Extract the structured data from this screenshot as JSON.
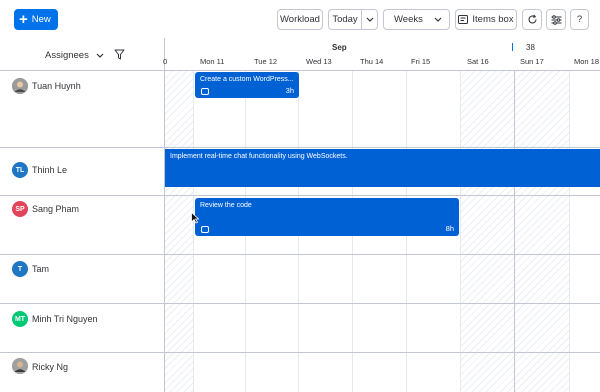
{
  "toolbar": {
    "new_label": "New",
    "workload_label": "Workload",
    "today_label": "Today",
    "view_label": "Weeks",
    "items_box_label": "Items box",
    "help_label": "?"
  },
  "left_header": {
    "title": "Assignees"
  },
  "timeline": {
    "month": "Sep",
    "week_number": "38",
    "days": [
      "0",
      "Mon 11",
      "Tue 12",
      "Wed 13",
      "Thu 14",
      "Fri 15",
      "Sat 16",
      "Sun 17",
      "Mon 18"
    ]
  },
  "assignees": [
    {
      "name": "Tuan Huynh",
      "initials": "",
      "color": "#8a8a8a"
    },
    {
      "name": "Thinh Le",
      "initials": "TL",
      "color": "#1f76c2"
    },
    {
      "name": "Sang Pham",
      "initials": "SP",
      "color": "#e2445c"
    },
    {
      "name": "Tam",
      "initials": "T",
      "color": "#1f76c2"
    },
    {
      "name": "Minh Tri Nguyen",
      "initials": "MT",
      "color": "#00c875"
    },
    {
      "name": "Ricky Ng",
      "initials": "",
      "color": "#8a8a8a"
    }
  ],
  "tasks": [
    {
      "title": "Create a custom WordPress...",
      "hours": "3h"
    },
    {
      "title": "Implement real-time chat functionality using WebSockets.",
      "hours": ""
    },
    {
      "title": "Review the code",
      "hours": "8h"
    }
  ],
  "colors": {
    "accent": "#0073ea",
    "task": "#0061d5",
    "border": "#c3c6d4"
  },
  "icons": [
    "plus-icon",
    "chevron-down-icon",
    "items-box-icon",
    "refresh-icon",
    "settings-icon",
    "filter-icon",
    "note-icon",
    "cursor-icon"
  ]
}
